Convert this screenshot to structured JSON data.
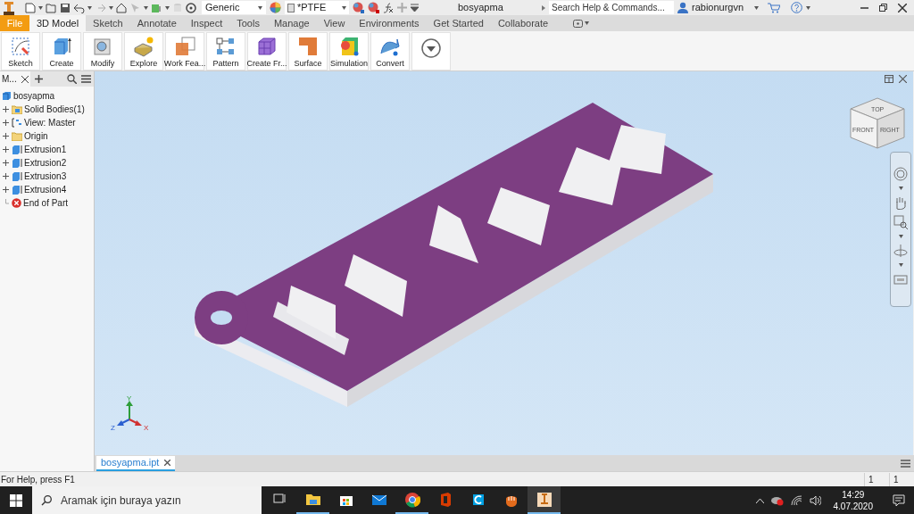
{
  "title_bar": {
    "appearance": "Generic",
    "material": "*PTFE",
    "document_title": "bosyapma",
    "search_placeholder": "Search Help & Commands...",
    "user": "rabionurgvn"
  },
  "menu_tabs": [
    {
      "label": "File",
      "kind": "file",
      "selected": false
    },
    {
      "label": "3D Model",
      "kind": "tab",
      "selected": true
    },
    {
      "label": "Sketch",
      "kind": "tab",
      "selected": false
    },
    {
      "label": "Annotate",
      "kind": "tab",
      "selected": false
    },
    {
      "label": "Inspect",
      "kind": "tab",
      "selected": false
    },
    {
      "label": "Tools",
      "kind": "tab",
      "selected": false
    },
    {
      "label": "Manage",
      "kind": "tab",
      "selected": false
    },
    {
      "label": "View",
      "kind": "tab",
      "selected": false
    },
    {
      "label": "Environments",
      "kind": "tab",
      "selected": false
    },
    {
      "label": "Get Started",
      "kind": "tab",
      "selected": false
    },
    {
      "label": "Collaborate",
      "kind": "tab",
      "selected": false
    }
  ],
  "ribbon": [
    {
      "label": "Sketch",
      "kind": "sketch"
    },
    {
      "label": "Create",
      "kind": "create"
    },
    {
      "label": "Modify",
      "kind": "modify"
    },
    {
      "label": "Explore",
      "kind": "explore"
    },
    {
      "label": "Work Fea...",
      "kind": "work"
    },
    {
      "label": "Pattern",
      "kind": "pattern"
    },
    {
      "label": "Create Fr...",
      "kind": "frame"
    },
    {
      "label": "Surface",
      "kind": "surface"
    },
    {
      "label": "Simulation",
      "kind": "simulation"
    },
    {
      "label": "Convert",
      "kind": "convert"
    },
    {
      "kind": "more"
    }
  ],
  "browser": {
    "tab_label": "M...",
    "tree": {
      "label": "bosyapma",
      "kind": "part",
      "children": [
        {
          "label": "Solid Bodies(1)",
          "kind": "bodies",
          "expandable": true
        },
        {
          "label": "View: Master",
          "kind": "view",
          "expandable": true
        },
        {
          "label": "Origin",
          "kind": "folder",
          "expandable": true
        },
        {
          "label": "Extrusion1",
          "kind": "extrusion",
          "expandable": true
        },
        {
          "label": "Extrusion2",
          "kind": "extrusion",
          "expandable": true
        },
        {
          "label": "Extrusion3",
          "kind": "extrusion",
          "expandable": true
        },
        {
          "label": "Extrusion4",
          "kind": "extrusion",
          "expandable": true
        },
        {
          "label": "End of Part",
          "kind": "end",
          "expandable": false
        }
      ]
    }
  },
  "view_cube": [
    "TOP",
    "FRONT",
    "RIGHT"
  ],
  "axes": [
    "Y",
    "Z",
    "X"
  ],
  "document_tabs": [
    {
      "label": "bosyapma.ipt",
      "selected": true
    }
  ],
  "status_bar": {
    "help_text": "For Help, press F1",
    "counts": [
      "1",
      "1"
    ]
  },
  "taskbar": {
    "search_placeholder": "Aramak için buraya yazın",
    "apps": [
      {
        "kind": "task_view",
        "running": false,
        "selected": false
      },
      {
        "kind": "explorer",
        "running": true,
        "selected": false
      },
      {
        "kind": "store",
        "running": false,
        "selected": false
      },
      {
        "kind": "mail",
        "running": false,
        "selected": false
      },
      {
        "kind": "chrome",
        "running": true,
        "selected": false
      },
      {
        "kind": "office",
        "running": false,
        "selected": false
      },
      {
        "kind": "c_app",
        "running": false,
        "selected": false
      },
      {
        "kind": "hand_app",
        "running": false,
        "selected": false
      },
      {
        "kind": "inventor",
        "running": true,
        "selected": true
      }
    ],
    "time": "14:29",
    "date": "4.07.2020"
  }
}
